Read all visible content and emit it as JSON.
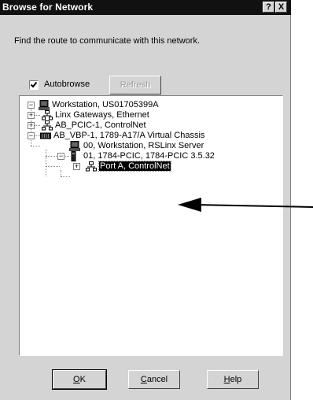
{
  "window": {
    "title": "Browse for Network",
    "help_button": "?",
    "close_button": "X"
  },
  "prompt": "Find the route to communicate with this network.",
  "autobrowse": {
    "label": "Autobrowse",
    "checked": true
  },
  "refresh_label": "Refresh",
  "tree": [
    {
      "label": "Workstation, US01705399A",
      "icon": "workstation-icon",
      "expander": "minus"
    },
    {
      "label": "Linx Gateways, Ethernet",
      "icon": "network-icon",
      "expander": "plus"
    },
    {
      "label": "AB_PCIC-1, ControlNet",
      "icon": "network-icon",
      "expander": "plus"
    },
    {
      "label": "AB_VBP-1, 1789-A17/A Virtual Chassis",
      "icon": "chassis-icon",
      "expander": "minus"
    },
    {
      "label": "00, Workstation, RSLinx Server",
      "icon": "workstation-icon",
      "expander": "none"
    },
    {
      "label": "01, 1784-PCIC, 1784-PCIC 3.5.32",
      "icon": "module-icon",
      "expander": "minus"
    },
    {
      "label": "Port A, ControlNet",
      "icon": "network-icon",
      "expander": "plus",
      "selected": true
    }
  ],
  "buttons": {
    "ok_mnemonic": "O",
    "ok_rest": "K",
    "cancel_mnemonic": "C",
    "cancel_rest": "ancel",
    "help_mnemonic": "H",
    "help_rest": "elp"
  },
  "colors": {
    "titlebar": "#111111",
    "dialog": "#d4d4d4",
    "selection": "#000000"
  }
}
